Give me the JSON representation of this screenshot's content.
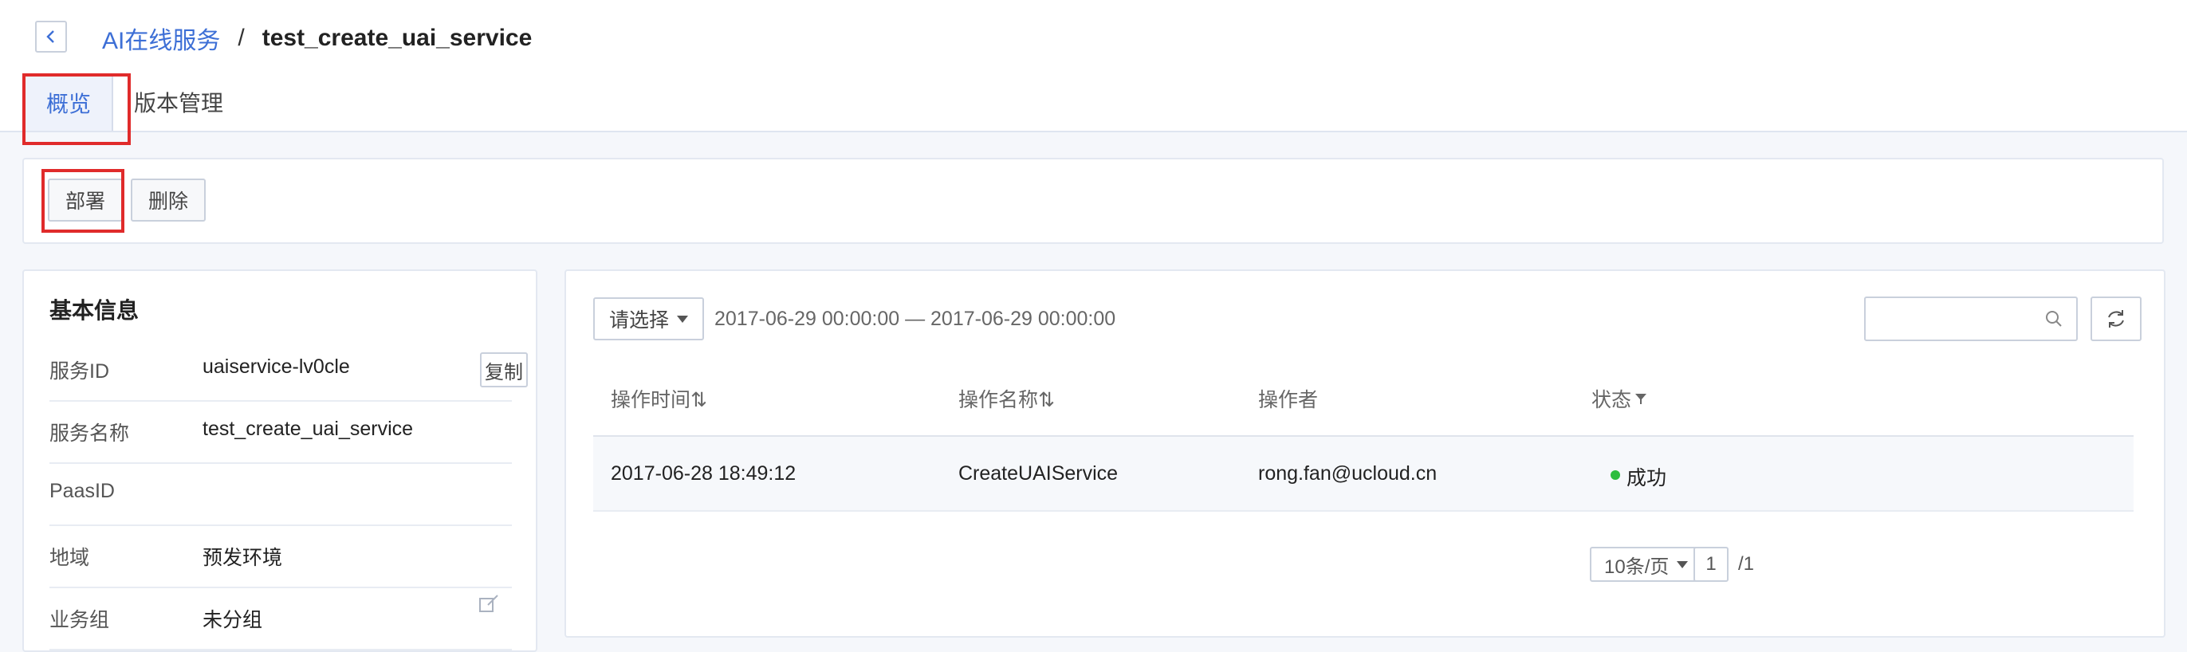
{
  "breadcrumb": {
    "parent": "AI在线服务",
    "separator": "/",
    "current": "test_create_uai_service"
  },
  "tabs": [
    {
      "label": "概览",
      "active": true
    },
    {
      "label": "版本管理",
      "active": false
    }
  ],
  "toolbar": {
    "deploy_label": "部署",
    "delete_label": "删除"
  },
  "basic_info": {
    "title": "基本信息",
    "rows": [
      {
        "label": "服务ID",
        "value": "uaiservice-lv0cle"
      },
      {
        "label": "服务名称",
        "value": "test_create_uai_service"
      },
      {
        "label": "PaasID",
        "value": ""
      },
      {
        "label": "地域",
        "value": "预发环境"
      },
      {
        "label": "业务组",
        "value": "未分组"
      }
    ],
    "copy_label": "复制"
  },
  "log": {
    "select_label": "请选择",
    "date_range": "2017-06-29 00:00:00 — 2017-06-29 00:00:00",
    "search_placeholder": "",
    "columns": [
      "操作时间⇅",
      "操作名称⇅",
      "操作者",
      "状态"
    ],
    "rows": [
      {
        "time": "2017-06-28 18:49:12",
        "name": "CreateUAIService",
        "operator": "rong.fan@ucloud.cn",
        "status": "成功"
      }
    ],
    "pagination": {
      "page_size": "10条/页",
      "page": "1",
      "total": "/1"
    }
  },
  "colors": {
    "accent": "#3d6fd6",
    "success": "#2dbd3e",
    "highlight": "#e02b2b"
  },
  "icons": [
    "back-arrow-icon",
    "caret-down-icon",
    "search-icon",
    "refresh-icon",
    "edit-icon",
    "filter-icon"
  ]
}
